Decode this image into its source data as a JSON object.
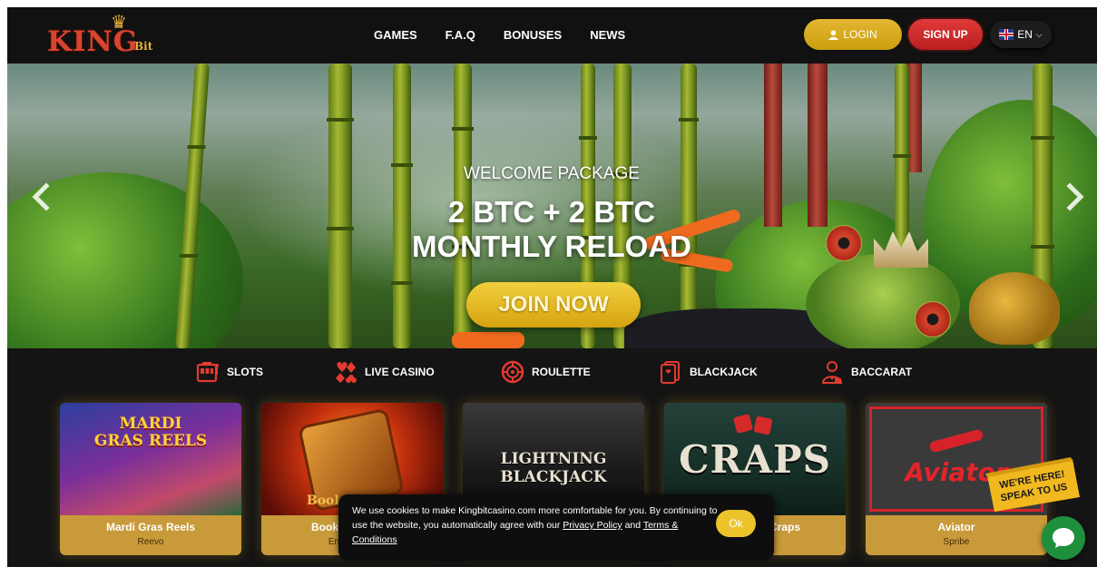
{
  "header": {
    "logo_text": "KING",
    "logo_sub": "Bit",
    "nav": [
      "GAMES",
      "F.A.Q",
      "BONUSES",
      "NEWS"
    ],
    "login_label": "LOGIN",
    "signup_label": "SIGN UP",
    "language": "EN"
  },
  "hero": {
    "subtitle": "WELCOME PACKAGE",
    "line1": "2 BTC + 2 BTC",
    "line2": "MONTHLY RELOAD",
    "cta": "JOIN NOW"
  },
  "categories": [
    {
      "label": "SLOTS",
      "icon": "slot-machine-icon"
    },
    {
      "label": "LIVE CASINO",
      "icon": "card-suits-icon"
    },
    {
      "label": "ROULETTE",
      "icon": "roulette-icon"
    },
    {
      "label": "BLACKJACK",
      "icon": "playing-card-icon"
    },
    {
      "label": "BACCARAT",
      "icon": "dealer-icon"
    }
  ],
  "games": [
    {
      "name": "Mardi Gras Reels",
      "provider": "Reevo",
      "art": "MARDI GRAS REELS"
    },
    {
      "name": "Book",
      "provider": "En",
      "art": "Book"
    },
    {
      "name": "",
      "provider": "",
      "art": "LIGHTNING BLACKJACK"
    },
    {
      "name": "Craps",
      "provider": "n",
      "art": "CRAPS"
    },
    {
      "name": "Aviator",
      "provider": "Spribe",
      "art": "Aviator"
    }
  ],
  "cookie": {
    "text_before": "We use cookies to make Kingbitcasino.com more comfortable for you. By continuing to use the website, you automatically agree with our ",
    "privacy": "Privacy Policy",
    "and": " and ",
    "terms": "Terms & Conditions",
    "ok": "Ok"
  },
  "chat": {
    "badge": "WE'RE HERE! SPEAK TO US"
  },
  "colors": {
    "gold": "#e5b532",
    "red": "#e13a3a",
    "dark": "#141414",
    "card_gold": "#c89a3a",
    "chat_green": "#1f8f3c"
  }
}
